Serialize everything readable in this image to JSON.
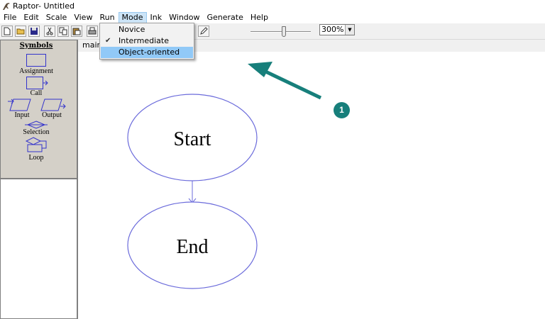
{
  "window": {
    "title": "Raptor- Untitled"
  },
  "menubar": {
    "items": [
      "File",
      "Edit",
      "Scale",
      "View",
      "Run",
      "Mode",
      "Ink",
      "Window",
      "Generate",
      "Help"
    ],
    "active": "Mode"
  },
  "mode_menu": {
    "items": [
      {
        "label": "Novice",
        "checked": false,
        "highlighted": false
      },
      {
        "label": "Intermediate",
        "checked": true,
        "highlighted": false
      },
      {
        "label": "Object-oriented",
        "checked": false,
        "highlighted": true
      }
    ]
  },
  "toolbar": {
    "zoom": {
      "value": "300%"
    },
    "icons": [
      "new-file-icon",
      "open-folder-icon",
      "save-icon",
      "cut-icon",
      "copy-icon",
      "paste-icon",
      "print-icon",
      "pen-icon"
    ]
  },
  "symbols": {
    "title": "Symbols",
    "items": [
      "Assignment",
      "Call",
      "Input",
      "Output",
      "Selection",
      "Loop"
    ]
  },
  "tabs": {
    "main": "main"
  },
  "flowchart": {
    "start_label": "Start",
    "end_label": "End",
    "stroke_color": "#6b6bdb"
  },
  "annotation": {
    "number": "1",
    "color": "#177f7b"
  }
}
